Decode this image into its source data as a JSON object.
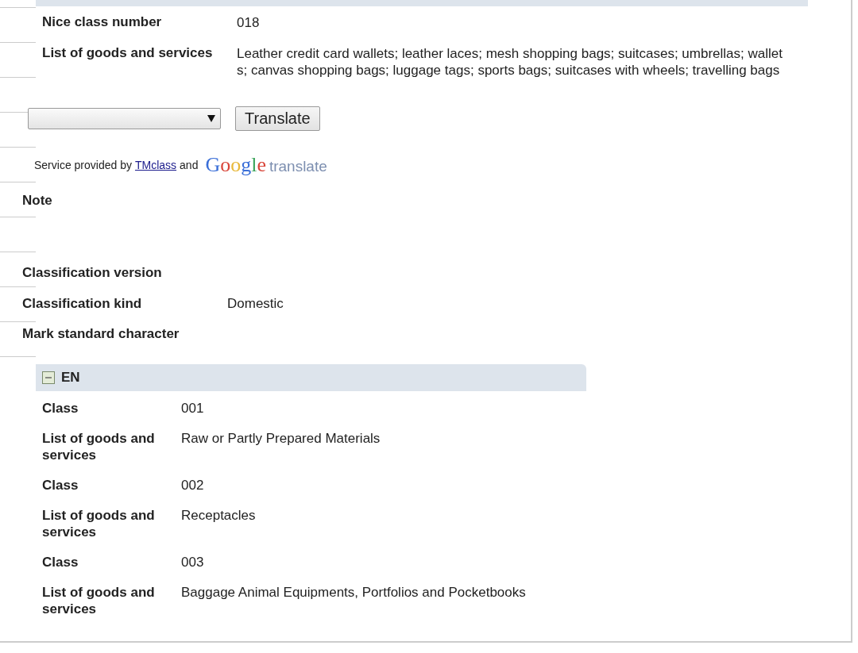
{
  "top_section": {
    "rows": [
      {
        "label": "Nice class number",
        "value_lines": [
          "018"
        ]
      },
      {
        "label": "List of goods and services",
        "value_lines": [
          "Leather credit card wallets; leather laces; mesh shopping bags; suitcases; umbrellas; wallet",
          "s; canvas shopping bags; luggage tags; sports bags; suitcases with wheels; travelling bags"
        ]
      }
    ]
  },
  "translate": {
    "button": "Translate"
  },
  "credit": {
    "prefix": "Service provided by",
    "link": "TMclass",
    "joiner": "and",
    "logo_word": "Google",
    "logo_suffix": "translate"
  },
  "details": [
    {
      "label": "Note"
    },
    {
      "label": "Classification version"
    },
    {
      "label": "Classification kind",
      "value": "Domestic"
    },
    {
      "label": "Mark standard character"
    }
  ],
  "en_section": {
    "title": "EN",
    "expanded": true,
    "rows": [
      {
        "label": "Class",
        "value": "001"
      },
      {
        "label": "List of goods and services",
        "value": "Raw or Partly Prepared Materials"
      },
      {
        "label": "Class",
        "value": "002"
      },
      {
        "label": "List of goods and services",
        "value": "Receptacles"
      },
      {
        "label": "Class",
        "value": "003"
      },
      {
        "label": "List of goods and services",
        "value": "Baggage Animal Equipments, Portfolios and Pocketbooks"
      }
    ]
  }
}
